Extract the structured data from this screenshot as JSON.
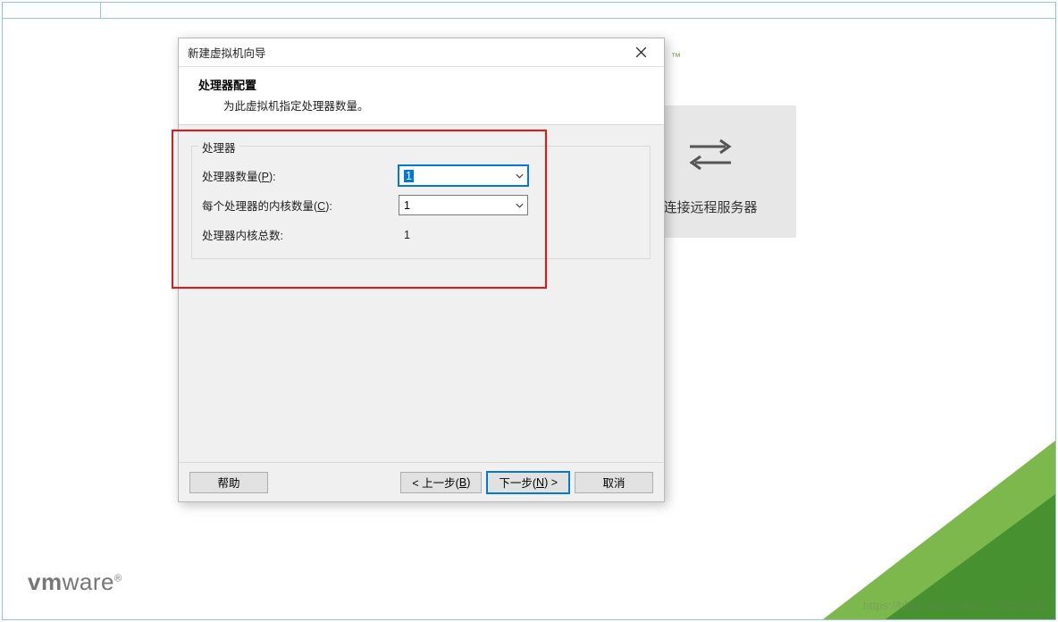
{
  "background": {
    "remote_card_label": "连接远程服务器",
    "tm": "™",
    "vmware_vm": "vm",
    "vmware_ware": "ware",
    "vmware_r": "®",
    "watermark": "https://blog.csdn.net/m0_37426353"
  },
  "dialog": {
    "title": "新建虚拟机向导",
    "head_title": "处理器配置",
    "head_sub": "为此虚拟机指定处理器数量。",
    "group_label": "处理器",
    "proc_count_label_pre": "处理器数量(",
    "proc_count_hotkey": "P",
    "proc_count_label_post": "):",
    "proc_count_value": "1",
    "cores_per_label_pre": "每个处理器的内核数量(",
    "cores_per_hotkey": "C",
    "cores_per_label_post": "):",
    "cores_per_value": "1",
    "total_label": "处理器内核总数:",
    "total_value": "1",
    "buttons": {
      "help": "帮助",
      "back_pre": "< 上一步(",
      "back_hot": "B",
      "back_post": ")",
      "next_pre": "下一步(",
      "next_hot": "N",
      "next_post": ") >",
      "cancel": "取消"
    }
  }
}
